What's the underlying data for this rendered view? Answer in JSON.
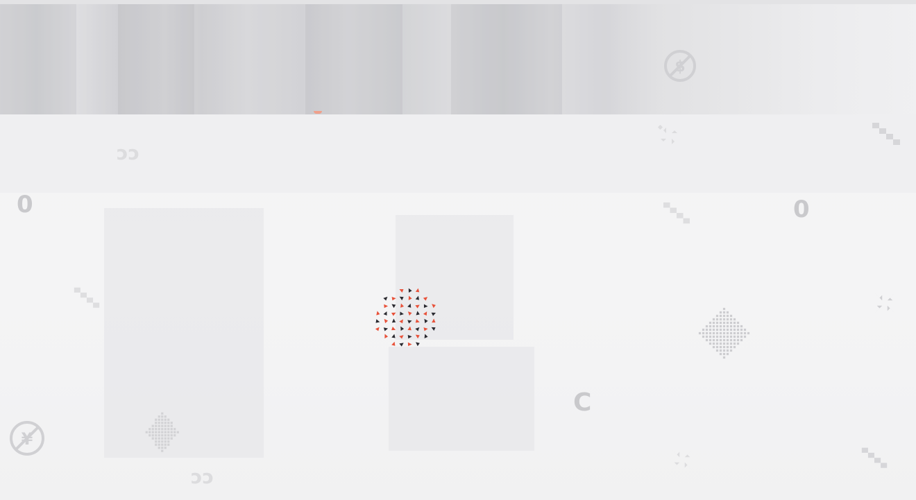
{
  "page": {
    "background": "#f2f2f3",
    "accent": "#e8523a",
    "dark": "#2a2a30"
  },
  "decor": {
    "zero_glyph": "0",
    "cc_glyph": "ɔɔ",
    "c_glyph": "C",
    "dollar_icon": "no-dollar-icon",
    "yen_icon": "no-yen-icon"
  },
  "loader": {
    "state": "loading"
  }
}
